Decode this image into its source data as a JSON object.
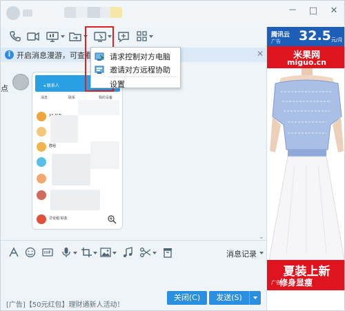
{
  "window": {
    "controls": {
      "minimize": "－",
      "maximize": "□",
      "close": "✕"
    }
  },
  "toolbar": {
    "icons": [
      "phone-icon",
      "video-call-icon",
      "screen-share-icon",
      "file-transfer-icon",
      "remote-assist-icon",
      "new-chat-icon",
      "apps-grid-icon"
    ]
  },
  "notice": {
    "text": "开启消息漫游，可查看在",
    "close": "✕"
  },
  "dropdown": {
    "items": [
      {
        "label": "请求控制对方电脑",
        "icon": "remote-control-icon"
      },
      {
        "label": "邀请对方远程协助",
        "icon": "remote-assist-icon"
      },
      {
        "label": "设置",
        "icon": ""
      }
    ]
  },
  "chat": {
    "side_glyph": "点",
    "phone": {
      "status_text": "◂  联系人",
      "tabs": [
        "消息",
        "联系",
        "我的设备"
      ],
      "rows": [
        {
          "text": "XX 好友",
          "color": "#f0a43c"
        },
        {
          "text": "",
          "color": "#f4c87a"
        },
        {
          "text": "群组",
          "color": "#f0b44c"
        },
        {
          "text": "",
          "color": "#58c0e8"
        },
        {
          "text": "",
          "color": "#f2a86a"
        },
        {
          "text": "",
          "color": "#d36a5e"
        },
        {
          "text": "讨论组·好友",
          "color": "#e0503a"
        }
      ]
    }
  },
  "input_toolbar": {
    "icons": [
      "font-icon",
      "emoji-icon",
      "gif-icon",
      "voice-icon",
      "screenshot-icon",
      "image-icon",
      "music-icon",
      "scissors-icon",
      "trash-icon"
    ],
    "history_label": "消息记录"
  },
  "bottom": {
    "ad_text": "[广告]【50元红包】理财通新人活动！",
    "close_label": "关闭(C)",
    "send_label": "发送(S)"
  },
  "ad": {
    "top_brand": "腾讯云",
    "top_tag": "广告",
    "price": "32.5",
    "unit": "元/月",
    "brand_title": "米果网",
    "brand_url": "miguo.cn",
    "slogan1": "夏装上新",
    "slogan2": "修身显瘦",
    "slogan_tag": "广告"
  },
  "colors": {
    "accent": "#2a8fe0",
    "highlight": "#e02020",
    "ad_red": "#e0141e",
    "ad_blue": "#1d5fb8"
  }
}
